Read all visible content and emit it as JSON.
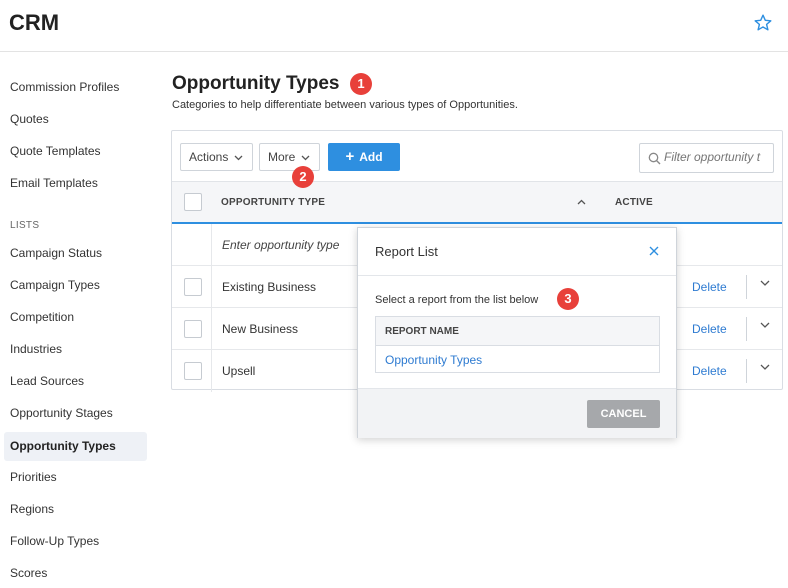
{
  "app": {
    "title": "CRM"
  },
  "sidebar": {
    "items_top": [
      "Commission Profiles",
      "Quotes",
      "Quote Templates",
      "Email Templates"
    ],
    "section_label": "LISTS",
    "items_lists": [
      "Campaign Status",
      "Campaign Types",
      "Competition",
      "Industries",
      "Lead Sources",
      "Opportunity Stages",
      "Opportunity Types",
      "Priorities",
      "Regions",
      "Follow-Up Types",
      "Scores"
    ],
    "active": "Opportunity Types"
  },
  "page": {
    "title": "Opportunity Types",
    "subtitle": "Categories to help differentiate between various types of Opportunities."
  },
  "toolbar": {
    "actions_label": "Actions",
    "more_label": "More",
    "add_label": "Add",
    "filter_placeholder": "Filter opportunity t"
  },
  "table": {
    "col_type": "OPPORTUNITY TYPE",
    "col_active": "ACTIVE",
    "entry_placeholder": "Enter opportunity type",
    "rows": [
      {
        "name": "Existing Business",
        "action": "Delete"
      },
      {
        "name": "New Business",
        "action": "Delete"
      },
      {
        "name": "Upsell",
        "action": "Delete"
      }
    ]
  },
  "modal": {
    "title": "Report List",
    "instruction": "Select a report from the list below",
    "col_report": "REPORT NAME",
    "reports": [
      "Opportunity Types"
    ],
    "cancel_label": "CANCEL"
  },
  "badges": [
    "1",
    "2",
    "3"
  ],
  "colors": {
    "accent": "#2e8fe0",
    "badge": "#e8403a",
    "link": "#2e7bd1"
  }
}
